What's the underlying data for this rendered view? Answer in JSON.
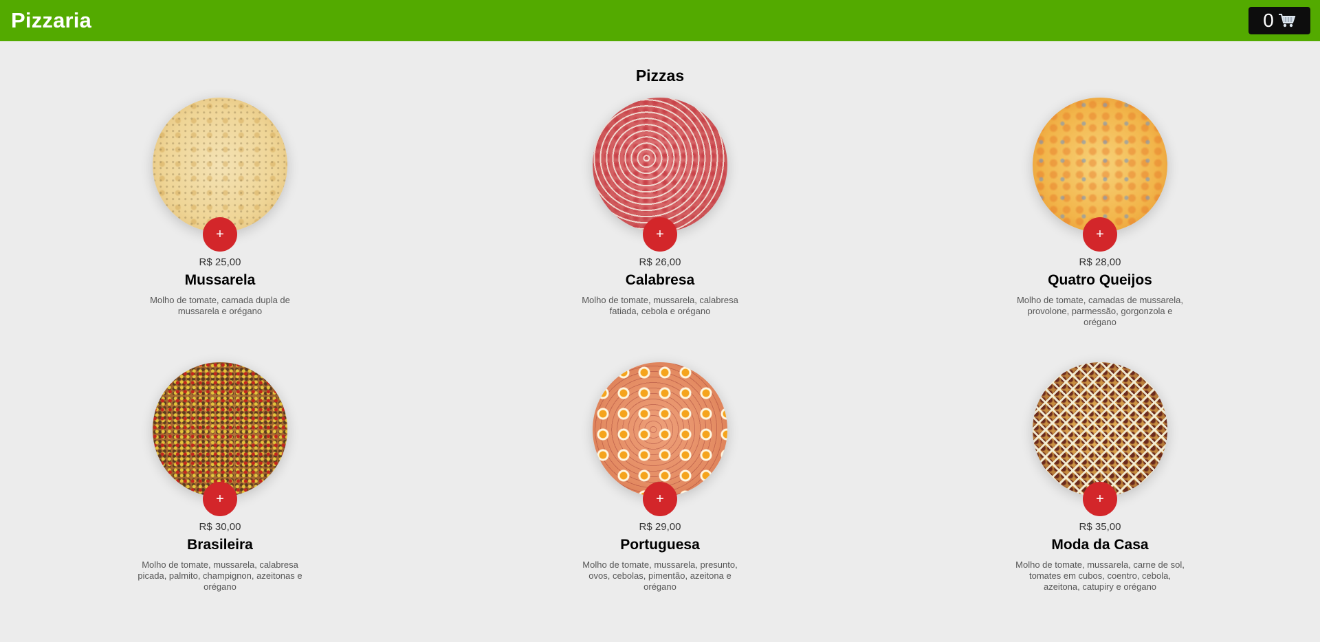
{
  "header": {
    "title": "Pizzaria",
    "cart_count": "0",
    "cart_icon": "cart-icon"
  },
  "section": {
    "title": "Pizzas"
  },
  "pizzas": [
    {
      "price": "R$ 25,00",
      "name": "Mussarela",
      "description": "Molho de tomate, camada dupla de mussarela e orégano",
      "add_label": "+",
      "style": "mussarela"
    },
    {
      "price": "R$ 26,00",
      "name": "Calabresa",
      "description": "Molho de tomate, mussarela, calabresa fatiada, cebola e orégano",
      "add_label": "+",
      "style": "calabresa"
    },
    {
      "price": "R$ 28,00",
      "name": "Quatro Queijos",
      "description": "Molho de tomate, camadas de mussarela, provolone, parmessão, gorgonzola e orégano",
      "add_label": "+",
      "style": "queijos"
    },
    {
      "price": "R$ 30,00",
      "name": "Brasileira",
      "description": "Molho de tomate, mussarela, calabresa picada, palmito, champignon, azeitonas e orégano",
      "add_label": "+",
      "style": "brasileira"
    },
    {
      "price": "R$ 29,00",
      "name": "Portuguesa",
      "description": "Molho de tomate, mussarela, presunto, ovos, cebolas, pimentão, azeitona e orégano",
      "add_label": "+",
      "style": "portuguesa"
    },
    {
      "price": "R$ 35,00",
      "name": "Moda da Casa",
      "description": "Molho de tomate, mussarela, carne de sol, tomates em cubos, coentro, cebola, azeitona, catupiry e orégano",
      "add_label": "+",
      "style": "casa"
    }
  ],
  "colors": {
    "header": "#53aa00",
    "add_button": "#d3262a",
    "cart": "#0d0d0d",
    "background": "#ececec"
  }
}
